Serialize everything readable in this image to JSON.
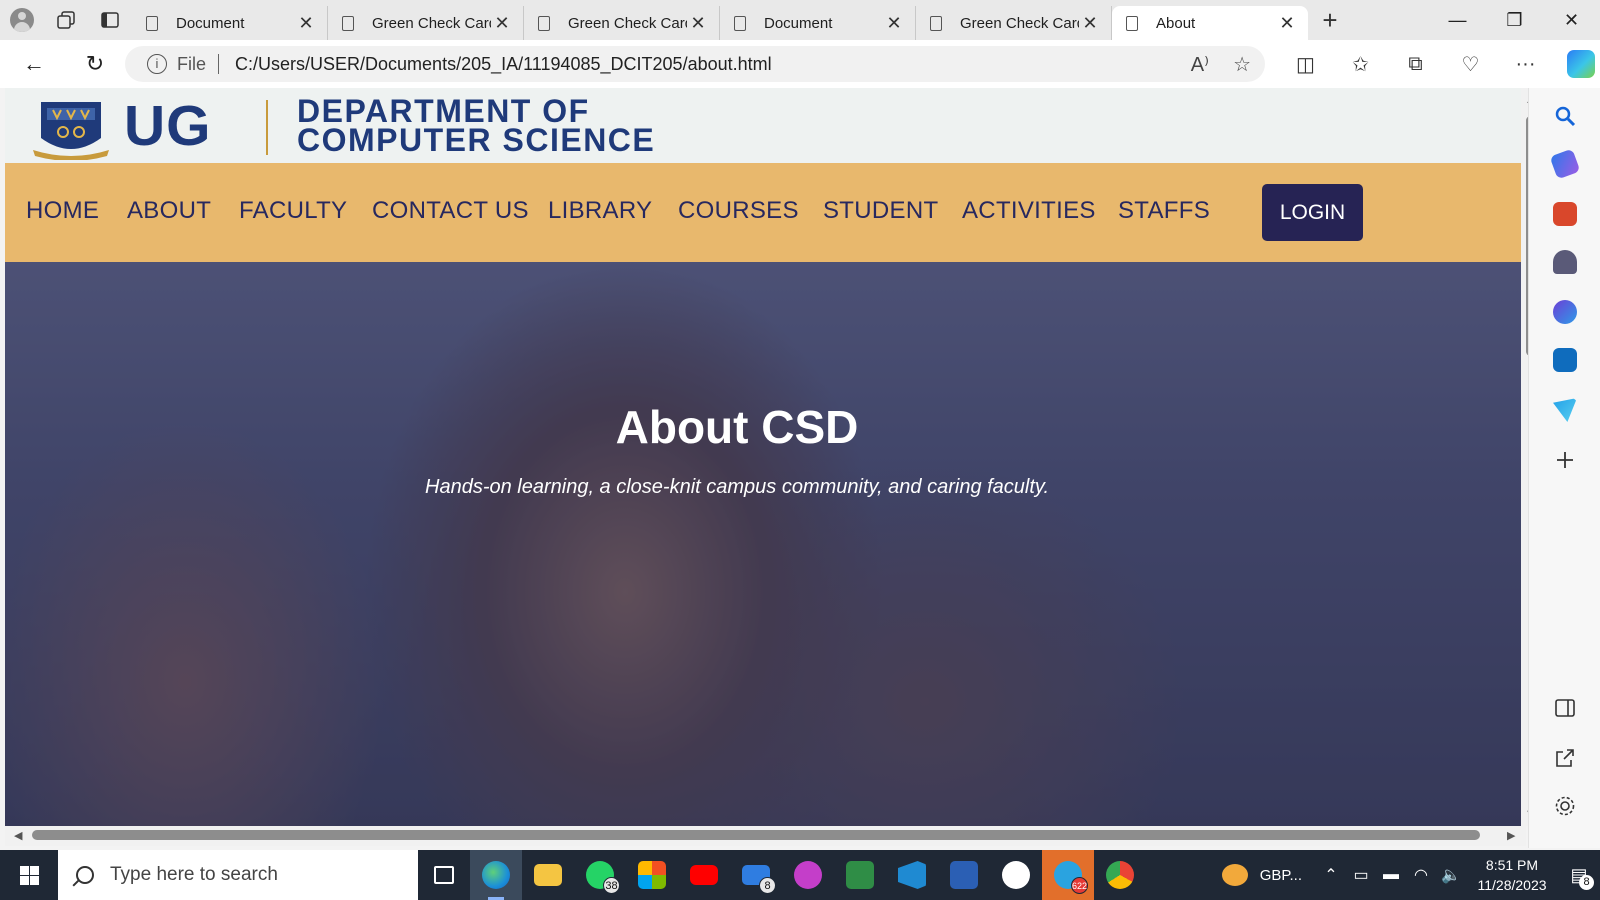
{
  "browser": {
    "tabs": [
      {
        "title": "Document",
        "active": false
      },
      {
        "title": "Green Check Card",
        "active": false
      },
      {
        "title": "Green Check Card",
        "active": false
      },
      {
        "title": "Document",
        "active": false
      },
      {
        "title": "Green Check Card",
        "active": false
      },
      {
        "title": "About",
        "active": true
      }
    ],
    "file_label": "File",
    "url": "C:/Users/USER/Documents/205_IA/11194085_DCIT205/about.html"
  },
  "site": {
    "logo_text": "UG",
    "dept_line1": "DEPARTMENT OF",
    "dept_line2": "COMPUTER SCIENCE",
    "nav": [
      "HOME",
      "ABOUT",
      "FACULTY",
      "CONTACT US",
      "LIBRARY",
      "COURSES",
      "STUDENT",
      "ACTIVITIES",
      "STAFFS"
    ],
    "login_label": "LOGIN",
    "hero_title": "About CSD",
    "hero_subtitle": "Hands-on learning, a close-knit campus community, and caring faculty."
  },
  "colors": {
    "nav_bg": "#e8b86d",
    "nav_text": "#27285f",
    "login_bg": "#262354",
    "brand_blue": "#1f3a7a",
    "accent_gold": "#c89b3c"
  },
  "taskbar": {
    "search_placeholder": "Type here to search",
    "whatsapp_badge": "38",
    "mail_badge": "8",
    "telegram_badge": "622",
    "tray_label": "GBP...",
    "time": "8:51 PM",
    "date": "11/28/2023",
    "notifications": "8"
  }
}
